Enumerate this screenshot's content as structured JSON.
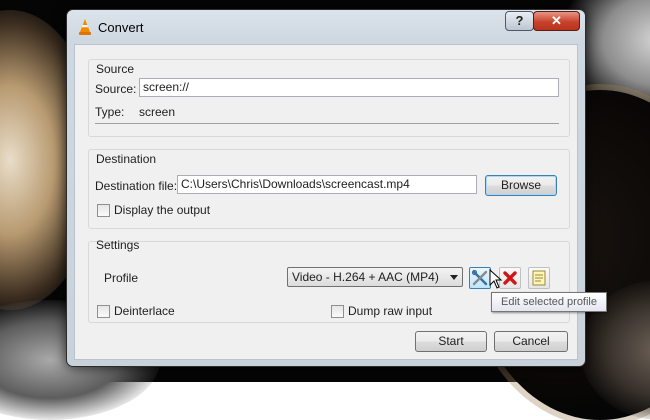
{
  "window": {
    "title": "Convert",
    "help_label": "?",
    "close_label": "✕"
  },
  "source": {
    "group_title": "Source",
    "source_label": "Source:",
    "source_value": "screen://",
    "type_label": "Type:",
    "type_value": "screen"
  },
  "destination": {
    "group_title": "Destination",
    "file_label": "Destination file:",
    "file_value": "C:\\Users\\Chris\\Downloads\\screencast.mp4",
    "browse_label": "Browse",
    "display_output_label": "Display the output",
    "display_output_checked": false
  },
  "settings": {
    "group_title": "Settings",
    "profile_label": "Profile",
    "profile_selected": "Video - H.264 + AAC (MP4)",
    "deinterlace_label": "Deinterlace",
    "deinterlace_checked": false,
    "dump_raw_label": "Dump raw input",
    "dump_raw_checked": false,
    "tooltip": "Edit selected profile",
    "icons": [
      "edit-profile-icon",
      "delete-profile-icon",
      "new-profile-icon"
    ]
  },
  "actions": {
    "start_label": "Start",
    "cancel_label": "Cancel"
  },
  "colors": {
    "close_button": "#c7422c",
    "delete_icon": "#d01616",
    "hover_border": "#3c7fb1"
  }
}
